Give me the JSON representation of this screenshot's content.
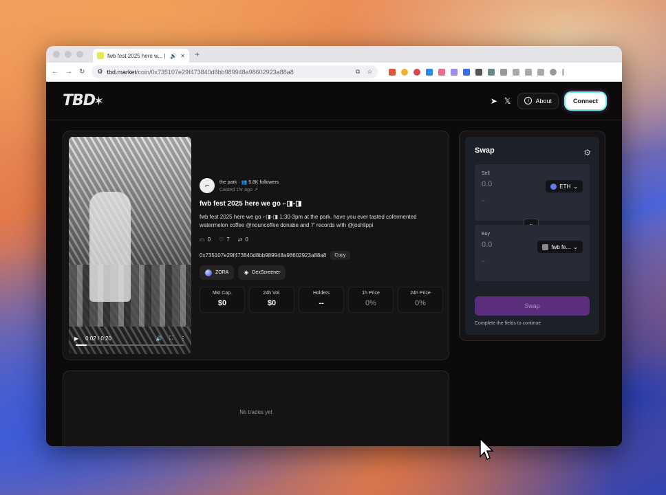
{
  "browser": {
    "tab_title": "fwb fest 2025 here w... |",
    "new_tab": "+",
    "url_domain": "tbd.market",
    "url_path": "/coin/0x735107e29f473840d8bb989948a98602923a88a8"
  },
  "header": {
    "logo": "TBD",
    "about_label": "About",
    "connect_label": "Connect"
  },
  "post": {
    "creator_name": "the park",
    "followers": "5.8K followers",
    "casted": "Casted 1hr ago",
    "title": "fwb fest 2025 here we go ⌐◨-◨",
    "description": "fwb fest 2025 here we go ⌐◨-◨ 1:30-3pm at the park. have you ever tasted cofermented watermelon coffee @nouncoffee donabe and 7' records with @joshlippi",
    "comments": "0",
    "likes": "7",
    "recasts": "0",
    "address": "0x735107e29f473840d8bb989948a98602923a88a8",
    "copy_label": "Copy",
    "link_zora": "ZORA",
    "link_dex": "DexScreener",
    "video_time": "0:02 / 0:20",
    "video_progress": 0.1
  },
  "metrics": [
    {
      "label": "Mkt Cap.",
      "value": "$0"
    },
    {
      "label": "24h Vol.",
      "value": "$0"
    },
    {
      "label": "Holders",
      "value": "--"
    },
    {
      "label": "1h Price",
      "value": "0%"
    },
    {
      "label": "24h Price",
      "value": "0%"
    }
  ],
  "trades": {
    "empty_text": "No trades yet"
  },
  "swap": {
    "title": "Swap",
    "sell_label": "Sell",
    "sell_amount": "0.0",
    "sell_token": "ETH",
    "sell_sub": "~",
    "buy_label": "Buy",
    "buy_amount": "0.0",
    "buy_token": "fwb fe...",
    "buy_sub": "~",
    "button_label": "Swap",
    "hint": "Complete the fields to continue"
  }
}
